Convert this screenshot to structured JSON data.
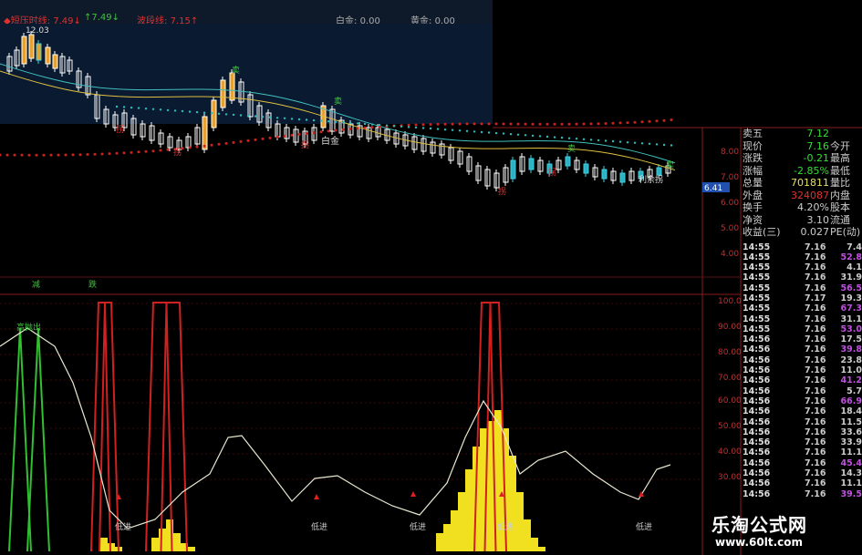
{
  "top_bar": {
    "items": [
      {
        "label": "短压时线",
        "value": "7.49",
        "color": "#e03030"
      },
      {
        "label": "",
        "value": "7.49",
        "color": "#40c040"
      },
      {
        "label": "波段线",
        "value": "7.15",
        "color": "#e03030"
      },
      {
        "label": "白金:",
        "value": "0.00",
        "color": "#aaaaaa"
      },
      {
        "label": "黄金:",
        "value": "0.00",
        "color": "#aaaaaa"
      }
    ]
  },
  "chart_labels": {
    "high_price": "12.03",
    "signal_sell": "卖",
    "signal_buy": "拐",
    "white_gold": "白金",
    "profit": "利余拐",
    "cur_price_tag": "6.41",
    "ind_left_1": "减",
    "ind_left_2": "跌",
    "ind_low_entry": "低进",
    "ind_arrow_out": "高抛出"
  },
  "price_axis": [
    "8.00",
    "7.00",
    "6.00",
    "5.00",
    "4.00"
  ],
  "indicator_axis": [
    "100.0",
    "90.00",
    "80.00",
    "70.00",
    "60.00",
    "50.00",
    "40.00",
    "30.00"
  ],
  "quote_panel": [
    {
      "label": "卖五",
      "value": "7.12",
      "right": "",
      "color": "#30e030"
    },
    {
      "label": "现价",
      "value": "7.16",
      "right": "今开",
      "color": "#30e030"
    },
    {
      "label": "涨跌",
      "value": "-0.21",
      "right": "最高",
      "color": "#30e030"
    },
    {
      "label": "涨幅",
      "value": "-2.85%",
      "right": "最低",
      "color": "#30e030"
    },
    {
      "label": "总量",
      "value": "701811",
      "right": "量比",
      "color": "#e8e060"
    },
    {
      "label": "外盘",
      "value": "324087",
      "right": "内盘",
      "color": "#e03030"
    },
    {
      "label": "换手",
      "value": "4.20%",
      "right": "股本",
      "color": "#cccccc"
    },
    {
      "label": "净资",
      "value": "3.10",
      "right": "流通",
      "color": "#cccccc"
    },
    {
      "label": "收益(三)",
      "value": "0.027",
      "right": "PE(动)",
      "color": "#cccccc"
    }
  ],
  "ticks": [
    {
      "time": "14:55",
      "price": "7.16",
      "vol": "7.4",
      "color": "#cccccc"
    },
    {
      "time": "14:55",
      "price": "7.16",
      "vol": "52.8",
      "color": "#c050e0"
    },
    {
      "time": "14:55",
      "price": "7.16",
      "vol": "4.1",
      "color": "#cccccc"
    },
    {
      "time": "14:55",
      "price": "7.16",
      "vol": "31.9",
      "color": "#cccccc"
    },
    {
      "time": "14:55",
      "price": "7.16",
      "vol": "56.5",
      "color": "#c050e0"
    },
    {
      "time": "14:55",
      "price": "7.17",
      "vol": "19.3",
      "color": "#cccccc"
    },
    {
      "time": "14:55",
      "price": "7.16",
      "vol": "67.3",
      "color": "#c050e0"
    },
    {
      "time": "14:55",
      "price": "7.16",
      "vol": "31.1",
      "color": "#cccccc"
    },
    {
      "time": "14:55",
      "price": "7.16",
      "vol": "53.0",
      "color": "#c050e0"
    },
    {
      "time": "14:56",
      "price": "7.16",
      "vol": "17.5",
      "color": "#cccccc"
    },
    {
      "time": "14:56",
      "price": "7.16",
      "vol": "39.8",
      "color": "#c050e0"
    },
    {
      "time": "14:56",
      "price": "7.16",
      "vol": "23.8",
      "color": "#cccccc"
    },
    {
      "time": "14:56",
      "price": "7.16",
      "vol": "11.0",
      "color": "#cccccc"
    },
    {
      "time": "14:56",
      "price": "7.16",
      "vol": "41.2",
      "color": "#c050e0"
    },
    {
      "time": "14:56",
      "price": "7.16",
      "vol": "5.7",
      "color": "#cccccc"
    },
    {
      "time": "14:56",
      "price": "7.16",
      "vol": "66.9",
      "color": "#c050e0"
    },
    {
      "time": "14:56",
      "price": "7.16",
      "vol": "18.4",
      "color": "#cccccc"
    },
    {
      "time": "14:56",
      "price": "7.16",
      "vol": "11.5",
      "color": "#cccccc"
    },
    {
      "time": "14:56",
      "price": "7.16",
      "vol": "33.6",
      "color": "#cccccc"
    },
    {
      "time": "14:56",
      "price": "7.16",
      "vol": "33.9",
      "color": "#cccccc"
    },
    {
      "time": "14:56",
      "price": "7.16",
      "vol": "11.1",
      "color": "#cccccc"
    },
    {
      "time": "14:56",
      "price": "7.16",
      "vol": "45.4",
      "color": "#c050e0"
    },
    {
      "time": "14:56",
      "price": "7.16",
      "vol": "14.3",
      "color": "#cccccc"
    },
    {
      "time": "14:56",
      "price": "7.16",
      "vol": "11.1",
      "color": "#cccccc"
    },
    {
      "time": "14:56",
      "price": "7.16",
      "vol": "39.5",
      "color": "#c050e0"
    }
  ],
  "watermark": {
    "title": "乐淘公式网",
    "url": "www.60lt.com"
  }
}
